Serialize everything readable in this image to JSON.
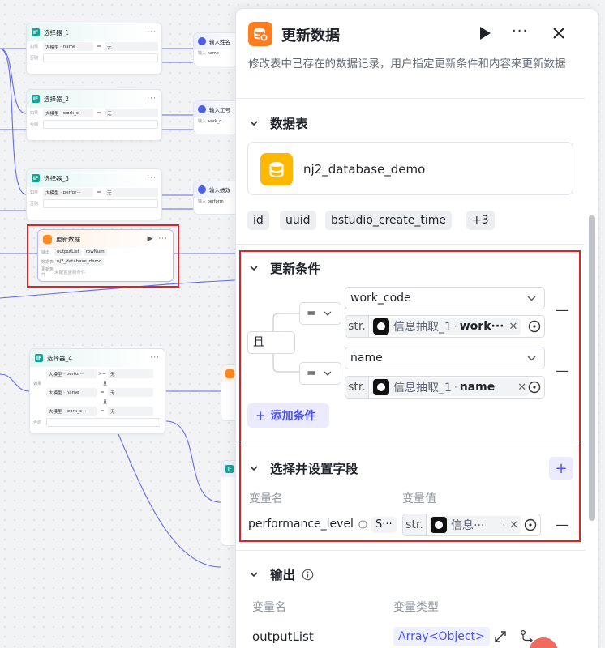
{
  "canvas": {
    "nodes": {
      "selector1": {
        "title": "选择器_1",
        "if_label": "如果",
        "else_label": "否则",
        "var_tag": "大模型",
        "var_name": "name",
        "op": "=",
        "value": "无"
      },
      "selector2": {
        "title": "选择器_2",
        "if_label": "如果",
        "else_label": "否则",
        "var_tag": "大模型",
        "var_name": "work_c···",
        "op": "=",
        "value": "无"
      },
      "selector3": {
        "title": "选择器_3",
        "if_label": "如果",
        "else_label": "否则",
        "var_tag": "大模型",
        "var_name": "perfor···",
        "op": "=",
        "value": "无"
      },
      "selector4": {
        "title": "选择器_4",
        "if_label": "如果",
        "else_label": "否则",
        "and_label": "且",
        "rows": [
          {
            "var_tag": "大模型",
            "var_name": "perfor···",
            "op": ">=",
            "value": "无"
          },
          {
            "var_tag": "大模型",
            "var_name": "name",
            "op": "=",
            "value": "无"
          },
          {
            "var_tag": "大模型",
            "var_name": "work_c···",
            "op": "=",
            "value": "无"
          }
        ]
      },
      "input_name": {
        "title": "输入姓名",
        "row_label": "输入",
        "var": "name"
      },
      "input_work": {
        "title": "输入工号",
        "row_label": "输入",
        "var": "work_c"
      },
      "input_perf": {
        "title": "输入绩效",
        "row_label": "输入",
        "var": "perform"
      },
      "update": {
        "title": "更新数据",
        "output_label": "输出",
        "out1": "outputList",
        "out2": "rowNum",
        "table_label": "数据表",
        "table_name": "nj2_database_demo",
        "cond_label": "更新条件",
        "cond_value": "未配置更新条件"
      }
    }
  },
  "panel": {
    "title": "更新数据",
    "description": "修改表中已存在的数据记录，用户指定更新条件和内容来更新数据",
    "table_section": {
      "title": "数据表",
      "table_name": "nj2_database_demo",
      "fields": [
        "id",
        "uuid",
        "bstudio_create_time",
        "+3"
      ]
    },
    "condition_section": {
      "title": "更新条件",
      "logic": "且",
      "conditions": [
        {
          "op": "=",
          "field": "work_code",
          "type": "str.",
          "ref_node": "信息抽取_1",
          "ref_field": "work···"
        },
        {
          "op": "=",
          "field": "name",
          "type": "str.",
          "ref_node": "信息抽取_1",
          "ref_field": "name"
        }
      ],
      "add_label": "添加条件"
    },
    "fields_section": {
      "title": "选择并设置字段",
      "col_name": "变量名",
      "col_value": "变量值",
      "rows": [
        {
          "name": "performance_level",
          "type_abbr": "S···",
          "type": "str.",
          "ref_node": "信息···",
          "ref_dot": "·"
        }
      ]
    },
    "output_section": {
      "title": "输出",
      "col_name": "变量名",
      "col_type": "变量类型",
      "rows": [
        {
          "name": "outputList",
          "type": "Array<Object>"
        }
      ]
    }
  },
  "colors": {
    "accent": "#4d53e8",
    "highlight": "#d6262c",
    "node_orange": "#ff7d1f",
    "db_yellow": "#ffb800"
  }
}
